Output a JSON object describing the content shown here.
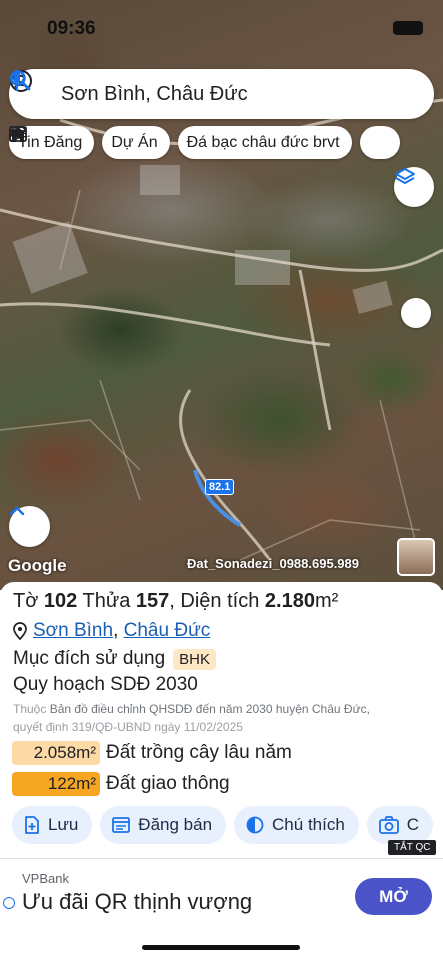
{
  "status_bar": {
    "time": "09:36"
  },
  "search": {
    "query": "Sơn Bình, Châu Đức"
  },
  "chips": [
    {
      "label": "Tin Đăng",
      "icon": "listing-icon"
    },
    {
      "label": "Dự Án",
      "icon": "house-icon"
    },
    {
      "label": "Đá bạc châu đức brvt",
      "icon": "ruler-icon"
    }
  ],
  "map": {
    "road_label": "82.1",
    "google_logo": "Google",
    "watermark": "Đat_Sonadezi_0988.695.989"
  },
  "parcel": {
    "to_label": "Tờ",
    "to_value": "102",
    "thua_label": "Thửa",
    "thua_value": "157",
    "area_label": ", Diện tích",
    "area_value": "2.180",
    "area_unit": "m²",
    "location": {
      "commune": "Sơn Bình",
      "district": "Châu Đức"
    },
    "purpose_label": "Mục đích sử dụng",
    "purpose_code": "BHK",
    "plan_label": "Quy hoạch SDĐ 2030",
    "note_prefix": "Thuộc",
    "note_line1": "Bản đồ điều chỉnh QHSDĐ đến năm 2030 huyện Châu Đức,",
    "note_line2": "quyết định 319/QĐ-UBND ngày 11/02/2025",
    "zones": [
      {
        "area": "2.058m²",
        "label": "Đất trồng cây lâu năm",
        "color": "#fdd9a5"
      },
      {
        "area": "122m²",
        "label": "Đất giao thông",
        "color": "#f5a623"
      }
    ]
  },
  "actions": [
    {
      "label": "Lưu",
      "icon": "save-icon"
    },
    {
      "label": "Đăng bán",
      "icon": "post-icon"
    },
    {
      "label": "Chú thích",
      "icon": "legend-icon"
    },
    {
      "label": "C",
      "icon": "camera-icon"
    }
  ],
  "ad": {
    "tag": "TẮT QC",
    "brand": "VPBank",
    "headline": "Ưu đãi QR thịnh vượng",
    "cta": "MỞ"
  }
}
